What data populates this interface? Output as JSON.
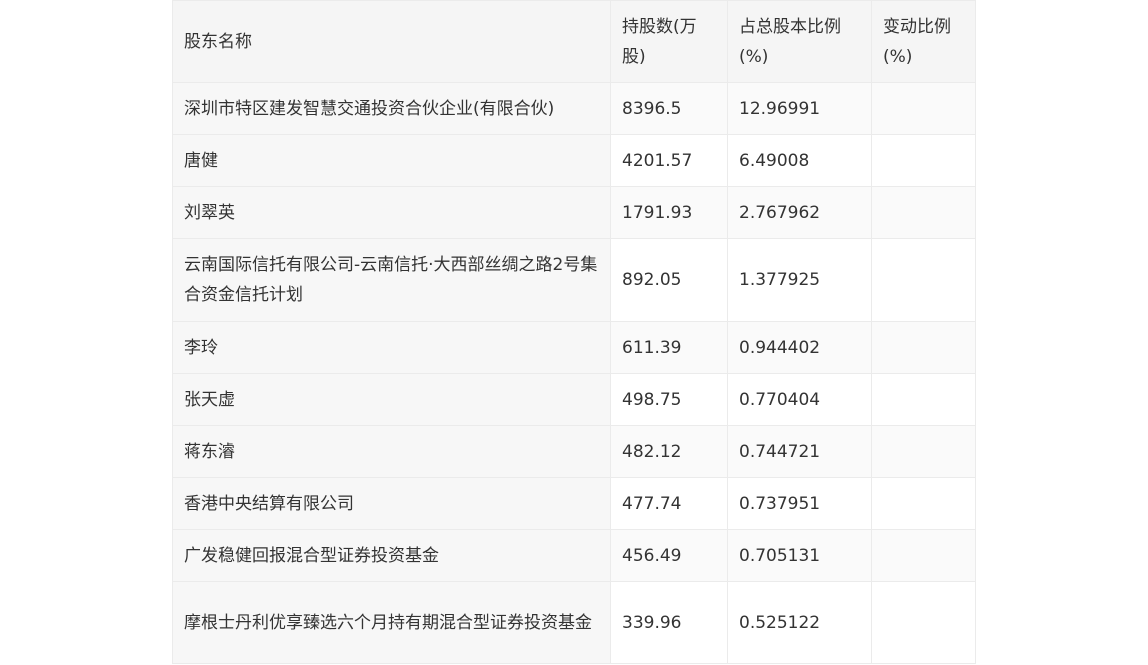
{
  "table": {
    "headers": {
      "name": "股东名称",
      "shares": "持股数(万股)",
      "ratio": "占总股本比例(%)",
      "change": "变动比例(%)"
    },
    "rows": [
      {
        "name": "深圳市特区建发智慧交通投资合伙企业(有限合伙)",
        "shares": "8396.5",
        "ratio": "12.96991",
        "change": ""
      },
      {
        "name": "唐健",
        "shares": "4201.57",
        "ratio": "6.49008",
        "change": ""
      },
      {
        "name": "刘翠英",
        "shares": "1791.93",
        "ratio": "2.767962",
        "change": ""
      },
      {
        "name": "云南国际信托有限公司-云南信托·大西部丝绸之路2号集合资金信托计划",
        "shares": "892.05",
        "ratio": "1.377925",
        "change": ""
      },
      {
        "name": "李玲",
        "shares": "611.39",
        "ratio": "0.944402",
        "change": ""
      },
      {
        "name": "张天虚",
        "shares": "498.75",
        "ratio": "0.770404",
        "change": ""
      },
      {
        "name": "蒋东濬",
        "shares": "482.12",
        "ratio": "0.744721",
        "change": ""
      },
      {
        "name": "香港中央结算有限公司",
        "shares": "477.74",
        "ratio": "0.737951",
        "change": ""
      },
      {
        "name": "广发稳健回报混合型证券投资基金",
        "shares": "456.49",
        "ratio": "0.705131",
        "change": ""
      },
      {
        "name": "摩根士丹利优享臻选六个月持有期混合型证券投资基金",
        "shares": "339.96",
        "ratio": "0.525122",
        "change": ""
      }
    ]
  }
}
